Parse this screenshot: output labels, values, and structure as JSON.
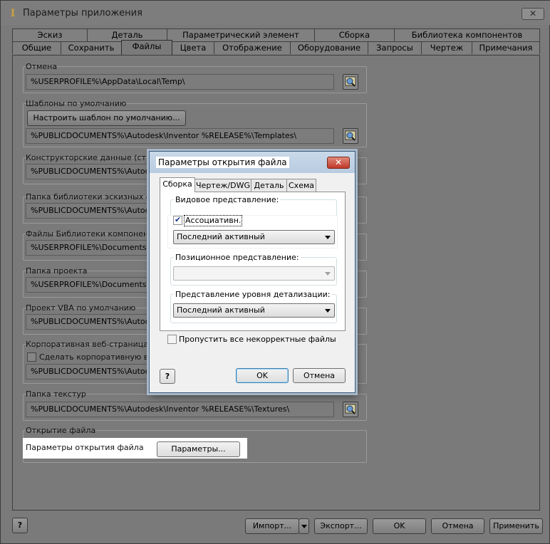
{
  "window": {
    "title": "Параметры приложения",
    "close_glyph": "✕"
  },
  "tabs_row1": [
    "Эскиз",
    "Деталь",
    "Параметрический элемент",
    "Сборка",
    "Библиотека компонентов"
  ],
  "tabs_row2": [
    "Общие",
    "Сохранить",
    "Файлы",
    "Цвета",
    "Отображение",
    "Оборудование",
    "Запросы",
    "Чертеж",
    "Примечания"
  ],
  "active_tab": "Файлы",
  "files": {
    "undo": {
      "label": "Отмена",
      "path": "%USERPROFILE%\\AppData\\Local\\Temp\\"
    },
    "templates": {
      "label": "Шаблоны по умолчанию",
      "button": "Настроить шаблон по умолчанию...",
      "path": "%PUBLICDOCUMENTS%\\Autodesk\\Inventor %RELEASE%\\Templates\\"
    },
    "design_data": {
      "label": "Конструкторские данные (стили и",
      "path": "%PUBLICDOCUMENTS%\\Autodesk"
    },
    "sketch_lib": {
      "label": "Папка библиотеки эскизных обозн",
      "path": "%PUBLICDOCUMENTS%\\Autodesk"
    },
    "component_lib": {
      "label": "Файлы Библиотеки компонентов п",
      "path": "%USERPROFILE%\\Documents\\Inven"
    },
    "project": {
      "label": "Папка проекта",
      "path": "%USERPROFILE%\\Documents\\Inven"
    },
    "vba": {
      "label": "Проект VBA по умолчанию",
      "path": "%PUBLICDOCUMENTS%\\Autodesk"
    },
    "web": {
      "label": "Корпоративная веб-страница",
      "checkbox": "Сделать корпоративную веб-с",
      "path": "%PUBLICDOCUMENTS%\\Autodesk"
    },
    "textures": {
      "label": "Папка текстур",
      "path": "%PUBLICDOCUMENTS%\\Autodesk\\Inventor %RELEASE%\\Textures\\"
    },
    "file_open": {
      "label": "Открытие файла",
      "options_label": "Параметры открытия файла",
      "button": "Параметры..."
    }
  },
  "bottom": {
    "import": "Импорт...",
    "export": "Экспорт...",
    "ok": "OK",
    "cancel": "Отмена",
    "apply": "Применить"
  },
  "dialog": {
    "title": "Параметры открытия файла",
    "close_glyph": "✕",
    "tabs": [
      "Сборка",
      "Чертеж/DWG",
      "Деталь",
      "Схема"
    ],
    "active_tab": "Сборка",
    "view_rep": {
      "label": "Видовое представление:",
      "checkbox": "Ассоциативн.",
      "checked": true,
      "value": "Последний активный"
    },
    "positional_rep": {
      "label": "Позиционное представление:",
      "value": ""
    },
    "lod_rep": {
      "label": "Представление уровня детализации:",
      "value": "Последний активный"
    },
    "skip_checkbox": "Пропустить все некорректные файлы",
    "ok": "OK",
    "cancel": "Отмена"
  },
  "colors": {
    "window_bg": "#7a7a7a",
    "dialog_bg": "#f0f0f0",
    "dialog_title": "#c9d9ea",
    "close_red": "#c0392b"
  }
}
